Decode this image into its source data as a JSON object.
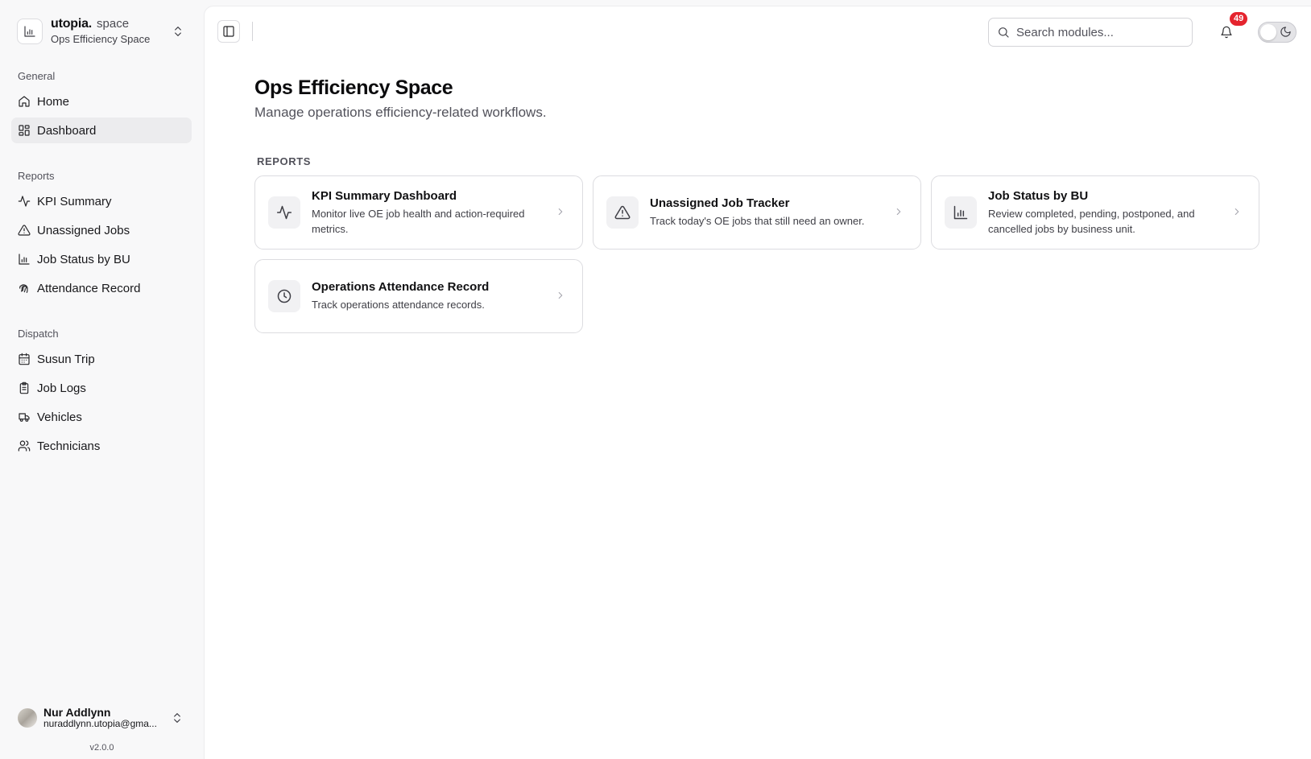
{
  "brand": {
    "name": "utopia.",
    "tag": "space",
    "subtitle": "Ops Efficiency Space",
    "logo_icon": "bar-chart-icon"
  },
  "sidebar": {
    "groups": [
      {
        "label": "General",
        "items": [
          {
            "label": "Home",
            "icon": "home-icon",
            "active": false
          },
          {
            "label": "Dashboard",
            "icon": "layout-dashboard-icon",
            "active": true
          }
        ]
      },
      {
        "label": "Reports",
        "items": [
          {
            "label": "KPI Summary",
            "icon": "activity-icon",
            "active": false
          },
          {
            "label": "Unassigned Jobs",
            "icon": "warning-triangle-icon",
            "active": false
          },
          {
            "label": "Job Status by BU",
            "icon": "bar-chart-icon",
            "active": false
          },
          {
            "label": "Attendance Record",
            "icon": "fingerprint-icon",
            "active": false
          }
        ]
      },
      {
        "label": "Dispatch",
        "items": [
          {
            "label": "Susun Trip",
            "icon": "calendar-icon",
            "active": false
          },
          {
            "label": "Job Logs",
            "icon": "clipboard-list-icon",
            "active": false
          },
          {
            "label": "Vehicles",
            "icon": "truck-icon",
            "active": false
          },
          {
            "label": "Technicians",
            "icon": "users-icon",
            "active": false
          }
        ]
      }
    ]
  },
  "user": {
    "name": "Nur Addlynn",
    "email": "nuraddlynn.utopia@gma..."
  },
  "version": "v2.0.0",
  "topbar": {
    "search_placeholder": "Search modules...",
    "notification_count": "49"
  },
  "page": {
    "title": "Ops Efficiency Space",
    "subtitle": "Manage operations efficiency-related workflows."
  },
  "reports_section": {
    "label": "REPORTS",
    "cards": [
      {
        "title": "KPI Summary Dashboard",
        "description": "Monitor live OE job health and action-required metrics.",
        "icon": "activity-icon"
      },
      {
        "title": "Unassigned Job Tracker",
        "description": "Track today's OE jobs that still need an owner.",
        "icon": "warning-triangle-icon"
      },
      {
        "title": "Job Status by BU",
        "description": "Review completed, pending, postponed, and cancelled jobs by business unit.",
        "icon": "bar-chart-icon"
      },
      {
        "title": "Operations Attendance Record",
        "description": "Track operations attendance records.",
        "icon": "clock-icon"
      }
    ]
  },
  "colors": {
    "badge": "#e5242e",
    "active_nav_bg": "#ececee",
    "sidebar_bg": "#f8f8f9"
  }
}
